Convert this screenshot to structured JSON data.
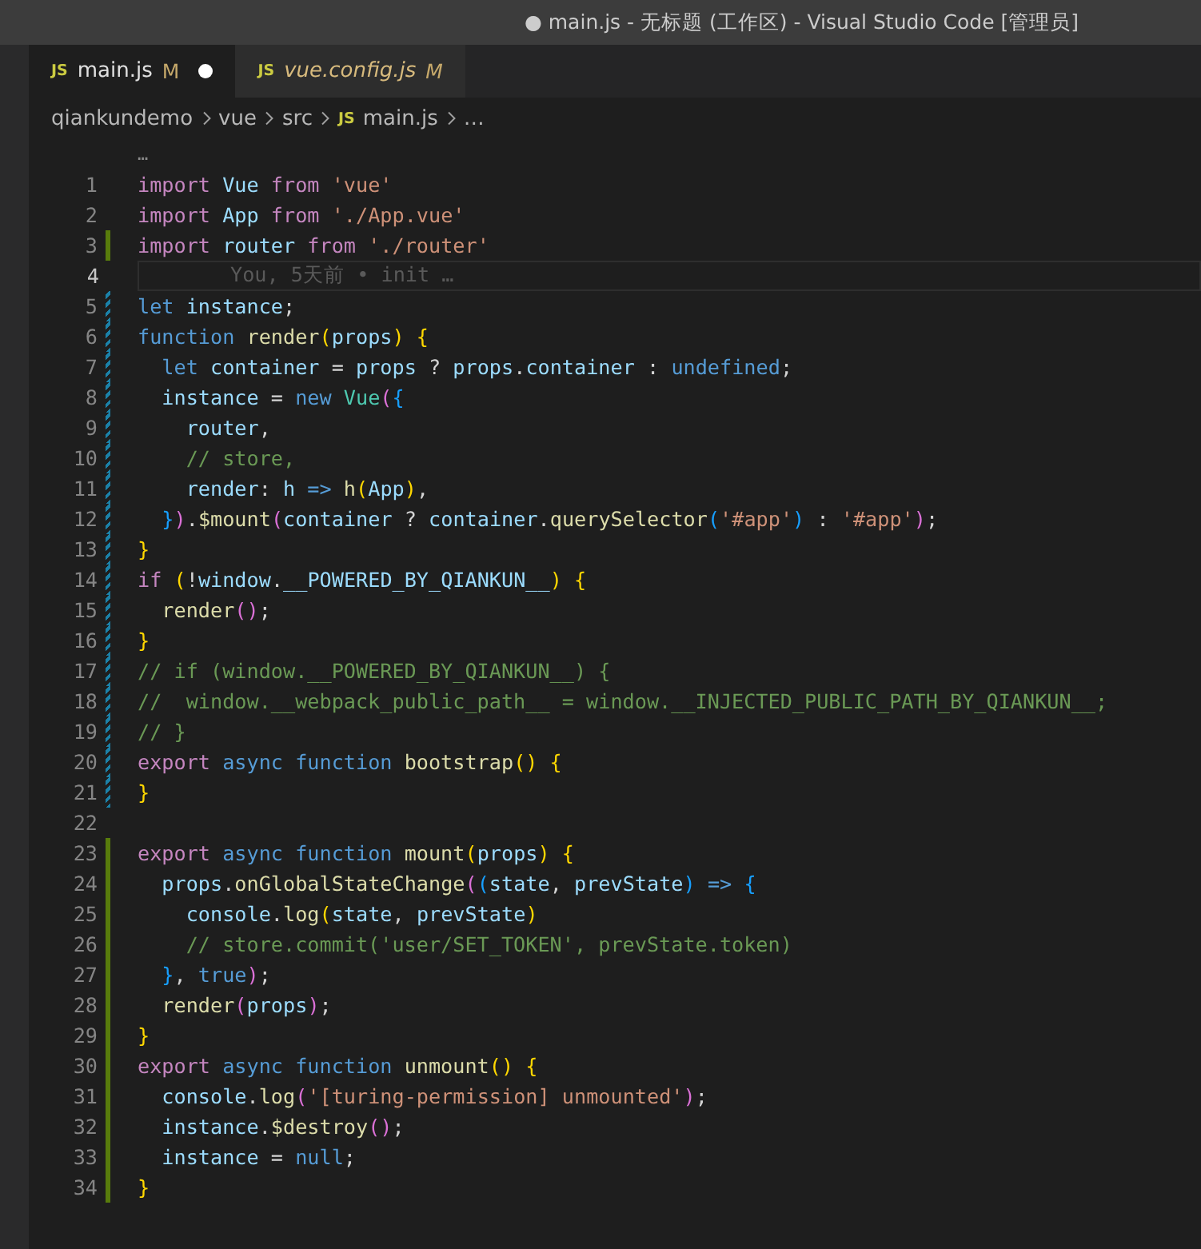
{
  "window": {
    "title": "● main.js - 无标题 (工作区) - Visual Studio Code [管理员]"
  },
  "tabs": [
    {
      "icon": "JS",
      "label": "main.js",
      "status": "M",
      "dirty": true,
      "preview": false,
      "selected": true
    },
    {
      "icon": "JS",
      "label": "vue.config.js",
      "status": "M",
      "dirty": false,
      "preview": true,
      "selected": false
    }
  ],
  "breadcrumbs": [
    {
      "label": "qiankundemo"
    },
    {
      "label": "vue"
    },
    {
      "label": "src"
    },
    {
      "icon": "JS",
      "label": "main.js"
    },
    {
      "label": "…"
    }
  ],
  "editor": {
    "sticky_hint": "…",
    "lines": [
      {
        "number": "1",
        "added": false,
        "modified": false,
        "tokens": [
          {
            "kind": "kw",
            "text": "import "
          },
          {
            "kind": "var",
            "text": "Vue "
          },
          {
            "kind": "kw",
            "text": "from "
          },
          {
            "kind": "str",
            "text": "'vue'"
          }
        ]
      },
      {
        "number": "2",
        "added": false,
        "modified": false,
        "tokens": [
          {
            "kind": "kw",
            "text": "import "
          },
          {
            "kind": "var",
            "text": "App "
          },
          {
            "kind": "kw",
            "text": "from "
          },
          {
            "kind": "str",
            "text": "'./App.vue'"
          }
        ]
      },
      {
        "number": "3",
        "added": true,
        "modified": false,
        "tokens": [
          {
            "kind": "kw",
            "text": "import "
          },
          {
            "kind": "var",
            "text": "router "
          },
          {
            "kind": "kw",
            "text": "from "
          },
          {
            "kind": "str",
            "text": "'./router'"
          }
        ]
      },
      {
        "number": "4",
        "added": false,
        "modified": false,
        "current": true,
        "blame": "You, 5天前 • init …"
      },
      {
        "number": "5",
        "added": false,
        "modified": true,
        "tokens": [
          {
            "kind": "st",
            "text": "let "
          },
          {
            "kind": "var",
            "text": "instance"
          },
          {
            "kind": "plain",
            "text": ";"
          }
        ]
      },
      {
        "number": "6",
        "added": false,
        "modified": true,
        "tokens": [
          {
            "kind": "st",
            "text": "function "
          },
          {
            "kind": "fn",
            "text": "render"
          },
          {
            "kind": "br1",
            "text": "("
          },
          {
            "kind": "var",
            "text": "props"
          },
          {
            "kind": "br1",
            "text": ") {"
          }
        ]
      },
      {
        "number": "7",
        "added": false,
        "modified": true,
        "tokens": [
          {
            "kind": "st",
            "text": "  let "
          },
          {
            "kind": "var",
            "text": "container"
          },
          {
            "kind": "plain",
            "text": " = "
          },
          {
            "kind": "var",
            "text": "props"
          },
          {
            "kind": "plain",
            "text": " ? "
          },
          {
            "kind": "var",
            "text": "props"
          },
          {
            "kind": "plain",
            "text": "."
          },
          {
            "kind": "var",
            "text": "container"
          },
          {
            "kind": "plain",
            "text": " : "
          },
          {
            "kind": "st",
            "text": "undefined"
          },
          {
            "kind": "plain",
            "text": ";"
          }
        ]
      },
      {
        "number": "8",
        "added": false,
        "modified": true,
        "tokens": [
          {
            "kind": "var",
            "text": "  instance"
          },
          {
            "kind": "plain",
            "text": " = "
          },
          {
            "kind": "st",
            "text": "new "
          },
          {
            "kind": "cls",
            "text": "Vue"
          },
          {
            "kind": "br2",
            "text": "("
          },
          {
            "kind": "br3",
            "text": "{"
          }
        ]
      },
      {
        "number": "9",
        "added": false,
        "modified": true,
        "tokens": [
          {
            "kind": "var",
            "text": "    router"
          },
          {
            "kind": "plain",
            "text": ","
          }
        ]
      },
      {
        "number": "10",
        "added": false,
        "modified": true,
        "tokens": [
          {
            "kind": "com",
            "text": "    // store,"
          }
        ]
      },
      {
        "number": "11",
        "added": false,
        "modified": true,
        "tokens": [
          {
            "kind": "var",
            "text": "    render"
          },
          {
            "kind": "plain",
            "text": ": "
          },
          {
            "kind": "var",
            "text": "h "
          },
          {
            "kind": "st",
            "text": "=> "
          },
          {
            "kind": "fn",
            "text": "h"
          },
          {
            "kind": "br1",
            "text": "("
          },
          {
            "kind": "var",
            "text": "App"
          },
          {
            "kind": "br1",
            "text": ")"
          },
          {
            "kind": "plain",
            "text": ","
          }
        ]
      },
      {
        "number": "12",
        "added": false,
        "modified": true,
        "tokens": [
          {
            "kind": "br3",
            "text": "  }"
          },
          {
            "kind": "br2",
            "text": ")"
          },
          {
            "kind": "plain",
            "text": "."
          },
          {
            "kind": "fn",
            "text": "$mount"
          },
          {
            "kind": "br2",
            "text": "("
          },
          {
            "kind": "var",
            "text": "container"
          },
          {
            "kind": "plain",
            "text": " ? "
          },
          {
            "kind": "var",
            "text": "container"
          },
          {
            "kind": "plain",
            "text": "."
          },
          {
            "kind": "fn",
            "text": "querySelector"
          },
          {
            "kind": "br3",
            "text": "("
          },
          {
            "kind": "str",
            "text": "'#app'"
          },
          {
            "kind": "br3",
            "text": ")"
          },
          {
            "kind": "plain",
            "text": " : "
          },
          {
            "kind": "str",
            "text": "'#app'"
          },
          {
            "kind": "br2",
            "text": ")"
          },
          {
            "kind": "plain",
            "text": ";"
          }
        ]
      },
      {
        "number": "13",
        "added": false,
        "modified": true,
        "tokens": [
          {
            "kind": "br1",
            "text": "}"
          }
        ]
      },
      {
        "number": "14",
        "added": false,
        "modified": true,
        "tokens": [
          {
            "kind": "kw",
            "text": "if "
          },
          {
            "kind": "br1",
            "text": "("
          },
          {
            "kind": "plain",
            "text": "!"
          },
          {
            "kind": "var",
            "text": "window"
          },
          {
            "kind": "plain",
            "text": "."
          },
          {
            "kind": "var",
            "text": "__POWERED_BY_QIANKUN__"
          },
          {
            "kind": "br1",
            "text": ") {"
          }
        ]
      },
      {
        "number": "15",
        "added": false,
        "modified": true,
        "tokens": [
          {
            "kind": "fn",
            "text": "  render"
          },
          {
            "kind": "br2",
            "text": "()"
          },
          {
            "kind": "plain",
            "text": ";"
          }
        ]
      },
      {
        "number": "16",
        "added": false,
        "modified": true,
        "tokens": [
          {
            "kind": "br1",
            "text": "}"
          }
        ]
      },
      {
        "number": "17",
        "added": false,
        "modified": true,
        "tokens": [
          {
            "kind": "com",
            "text": "// if (window.__POWERED_BY_QIANKUN__) {"
          }
        ]
      },
      {
        "number": "18",
        "added": false,
        "modified": true,
        "tokens": [
          {
            "kind": "com",
            "text": "//  window.__webpack_public_path__ = window.__INJECTED_PUBLIC_PATH_BY_QIANKUN__;"
          }
        ]
      },
      {
        "number": "19",
        "added": false,
        "modified": true,
        "tokens": [
          {
            "kind": "com",
            "text": "// }"
          }
        ]
      },
      {
        "number": "20",
        "added": false,
        "modified": true,
        "tokens": [
          {
            "kind": "kw",
            "text": "export "
          },
          {
            "kind": "st",
            "text": "async function "
          },
          {
            "kind": "fn",
            "text": "bootstrap"
          },
          {
            "kind": "br1",
            "text": "() {"
          }
        ]
      },
      {
        "number": "21",
        "added": false,
        "modified": true,
        "tokens": [
          {
            "kind": "br1",
            "text": "}"
          }
        ]
      },
      {
        "number": "22",
        "added": false,
        "modified": false
      },
      {
        "number": "23",
        "added": true,
        "modified": false,
        "tokens": [
          {
            "kind": "kw",
            "text": "export "
          },
          {
            "kind": "st",
            "text": "async function "
          },
          {
            "kind": "fn",
            "text": "mount"
          },
          {
            "kind": "br1",
            "text": "("
          },
          {
            "kind": "var",
            "text": "props"
          },
          {
            "kind": "br1",
            "text": ") {"
          }
        ]
      },
      {
        "number": "24",
        "added": true,
        "modified": false,
        "tokens": [
          {
            "kind": "var",
            "text": "  props"
          },
          {
            "kind": "plain",
            "text": "."
          },
          {
            "kind": "fn",
            "text": "onGlobalStateChange"
          },
          {
            "kind": "br2",
            "text": "("
          },
          {
            "kind": "br3",
            "text": "("
          },
          {
            "kind": "var",
            "text": "state"
          },
          {
            "kind": "plain",
            "text": ", "
          },
          {
            "kind": "var",
            "text": "prevState"
          },
          {
            "kind": "br3",
            "text": ") "
          },
          {
            "kind": "st",
            "text": "=> "
          },
          {
            "kind": "br3",
            "text": "{"
          }
        ]
      },
      {
        "number": "25",
        "added": true,
        "modified": false,
        "tokens": [
          {
            "kind": "var",
            "text": "    console"
          },
          {
            "kind": "plain",
            "text": "."
          },
          {
            "kind": "fn",
            "text": "log"
          },
          {
            "kind": "br1",
            "text": "("
          },
          {
            "kind": "var",
            "text": "state"
          },
          {
            "kind": "plain",
            "text": ", "
          },
          {
            "kind": "var",
            "text": "prevState"
          },
          {
            "kind": "br1",
            "text": ")"
          }
        ]
      },
      {
        "number": "26",
        "added": true,
        "modified": false,
        "tokens": [
          {
            "kind": "com",
            "text": "    // store.commit('user/SET_TOKEN', prevState.token)"
          }
        ]
      },
      {
        "number": "27",
        "added": true,
        "modified": false,
        "tokens": [
          {
            "kind": "br3",
            "text": "  }"
          },
          {
            "kind": "plain",
            "text": ", "
          },
          {
            "kind": "st",
            "text": "true"
          },
          {
            "kind": "br2",
            "text": ")"
          },
          {
            "kind": "plain",
            "text": ";"
          }
        ]
      },
      {
        "number": "28",
        "added": true,
        "modified": false,
        "tokens": [
          {
            "kind": "fn",
            "text": "  render"
          },
          {
            "kind": "br2",
            "text": "("
          },
          {
            "kind": "var",
            "text": "props"
          },
          {
            "kind": "br2",
            "text": ")"
          },
          {
            "kind": "plain",
            "text": ";"
          }
        ]
      },
      {
        "number": "29",
        "added": true,
        "modified": false,
        "tokens": [
          {
            "kind": "br1",
            "text": "}"
          }
        ]
      },
      {
        "number": "30",
        "added": true,
        "modified": false,
        "tokens": [
          {
            "kind": "kw",
            "text": "export "
          },
          {
            "kind": "st",
            "text": "async function "
          },
          {
            "kind": "fn",
            "text": "unmount"
          },
          {
            "kind": "br1",
            "text": "() {"
          }
        ]
      },
      {
        "number": "31",
        "added": true,
        "modified": false,
        "tokens": [
          {
            "kind": "var",
            "text": "  console"
          },
          {
            "kind": "plain",
            "text": "."
          },
          {
            "kind": "fn",
            "text": "log"
          },
          {
            "kind": "br2",
            "text": "("
          },
          {
            "kind": "str",
            "text": "'[turing-permission] unmounted'"
          },
          {
            "kind": "br2",
            "text": ")"
          },
          {
            "kind": "plain",
            "text": ";"
          }
        ]
      },
      {
        "number": "32",
        "added": true,
        "modified": false,
        "tokens": [
          {
            "kind": "var",
            "text": "  instance"
          },
          {
            "kind": "plain",
            "text": "."
          },
          {
            "kind": "fn",
            "text": "$destroy"
          },
          {
            "kind": "br2",
            "text": "()"
          },
          {
            "kind": "plain",
            "text": ";"
          }
        ]
      },
      {
        "number": "33",
        "added": true,
        "modified": false,
        "tokens": [
          {
            "kind": "var",
            "text": "  instance"
          },
          {
            "kind": "plain",
            "text": " = "
          },
          {
            "kind": "st",
            "text": "null"
          },
          {
            "kind": "plain",
            "text": ";"
          }
        ]
      },
      {
        "number": "34",
        "added": true,
        "modified": false,
        "tokens": [
          {
            "kind": "br1",
            "text": "}"
          }
        ]
      }
    ]
  }
}
